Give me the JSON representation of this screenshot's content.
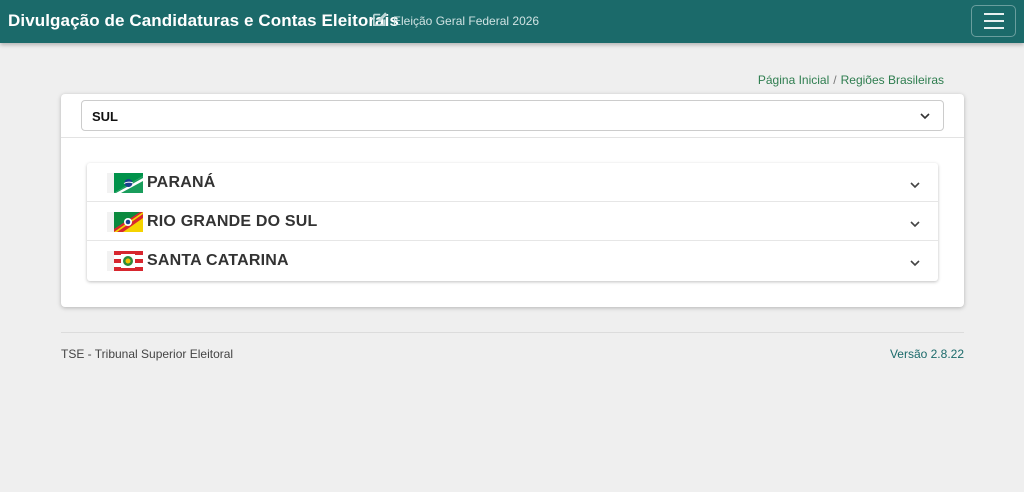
{
  "header": {
    "title": "Divulgação de Candidaturas e Contas Eleitorais",
    "subtitle": "Eleição Geral Federal 2026",
    "edit_icon": "edit-icon",
    "menu_icon": "hamburger-menu-icon",
    "bg_color": "#1b6a6a"
  },
  "breadcrumb": {
    "home": "Página Inicial",
    "separator": "/",
    "current": "Regiões Brasileiras"
  },
  "region_select": {
    "value": "SUL",
    "icon": "chevron-down-icon"
  },
  "states": [
    {
      "name": "PARANÁ",
      "flag": "parana-flag-icon"
    },
    {
      "name": "RIO GRANDE DO SUL",
      "flag": "rio-grande-do-sul-flag-icon"
    },
    {
      "name": "SANTA CATARINA",
      "flag": "santa-catarina-flag-icon"
    }
  ],
  "footer": {
    "left": "TSE - Tribunal Superior Eleitoral",
    "right": "Versão 2.8.22"
  }
}
